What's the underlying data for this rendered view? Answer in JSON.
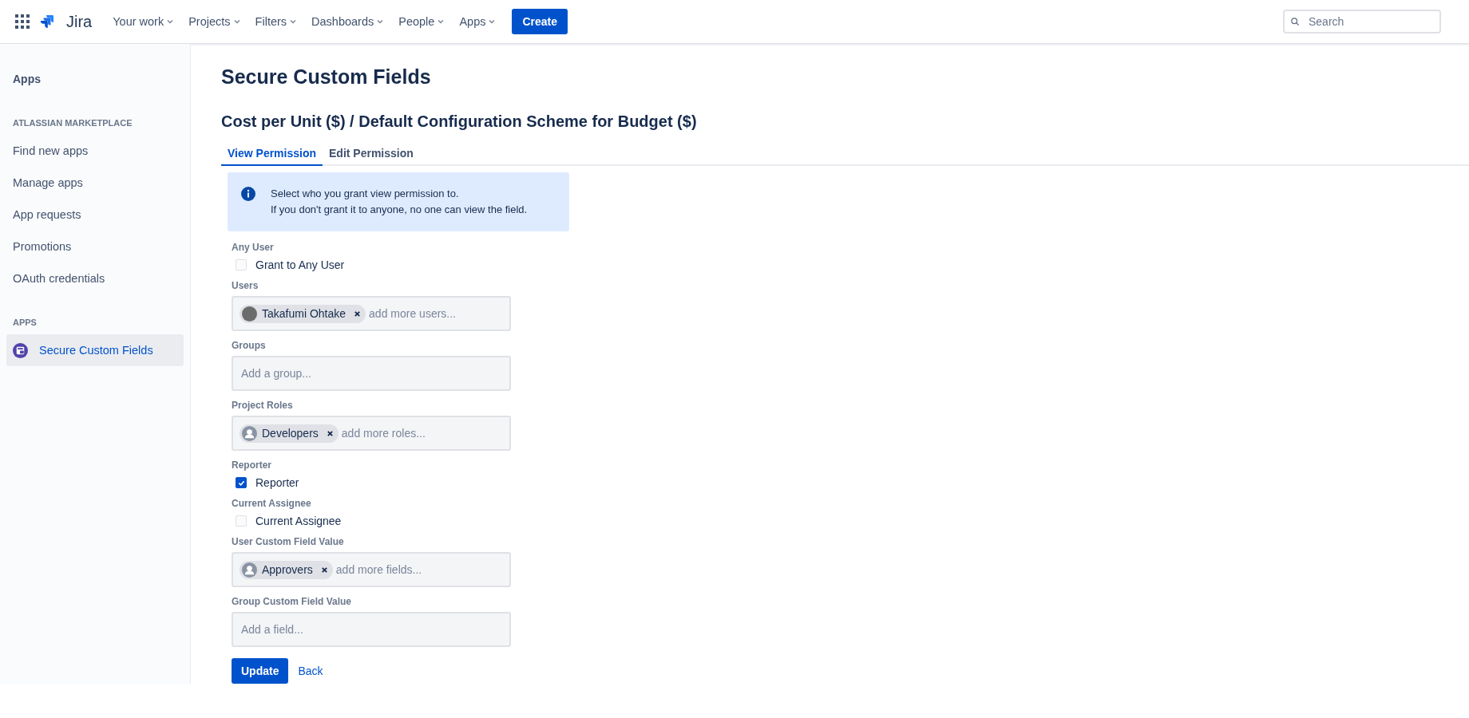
{
  "topbar": {
    "logo": "Jira",
    "nav": [
      {
        "label": "Your work"
      },
      {
        "label": "Projects"
      },
      {
        "label": "Filters"
      },
      {
        "label": "Dashboards"
      },
      {
        "label": "People"
      },
      {
        "label": "Apps"
      }
    ],
    "create": "Create",
    "search": {
      "placeholder": "Search"
    }
  },
  "sidebar": {
    "title": "Apps",
    "sections": [
      {
        "heading": "ATLASSIAN MARKETPLACE",
        "items": [
          {
            "label": "Find new apps",
            "selected": false
          },
          {
            "label": "Manage apps",
            "selected": false
          },
          {
            "label": "App requests",
            "selected": false
          },
          {
            "label": "Promotions",
            "selected": false
          },
          {
            "label": "OAuth credentials",
            "selected": false
          }
        ]
      },
      {
        "heading": "APPS",
        "items": [
          {
            "label": "Secure Custom Fields",
            "selected": true,
            "icon": true
          }
        ]
      }
    ]
  },
  "page": {
    "title": "Secure Custom Fields",
    "subtitle": "Cost per Unit ($) / Default Configuration Scheme for Budget ($)",
    "tabs": [
      {
        "label": "View Permission",
        "selected": true
      },
      {
        "label": "Edit Permission",
        "selected": false
      }
    ],
    "info": [
      "Select who you grant view permission to.",
      "If you don't grant it to anyone, no one can view the field."
    ],
    "fields": [
      {
        "kind": "checkbox",
        "label": "Any User",
        "option": "Grant to Any User",
        "checked": false
      },
      {
        "kind": "picker",
        "label": "Users",
        "tags": [
          {
            "text": "Takafumi Ohtake",
            "kind": "photo"
          }
        ],
        "placeholder": "add more users..."
      },
      {
        "kind": "picker",
        "label": "Groups",
        "placeholder": "Add a group..."
      },
      {
        "kind": "picker",
        "label": "Project Roles",
        "tags": [
          {
            "text": "Developers",
            "kind": "person"
          }
        ],
        "placeholder": "add more roles..."
      },
      {
        "kind": "checkbox",
        "label": "Reporter",
        "option": "Reporter",
        "checked": true
      },
      {
        "kind": "checkbox",
        "label": "Current Assignee",
        "option": "Current Assignee",
        "checked": false
      },
      {
        "kind": "picker",
        "label": "User Custom Field Value",
        "tags": [
          {
            "text": "Approvers",
            "kind": "person"
          }
        ],
        "placeholder": "add more fields..."
      },
      {
        "kind": "picker",
        "label": "Group Custom Field Value",
        "placeholder": "Add a field..."
      }
    ],
    "buttons": {
      "primary": "Update",
      "link": "Back"
    }
  }
}
